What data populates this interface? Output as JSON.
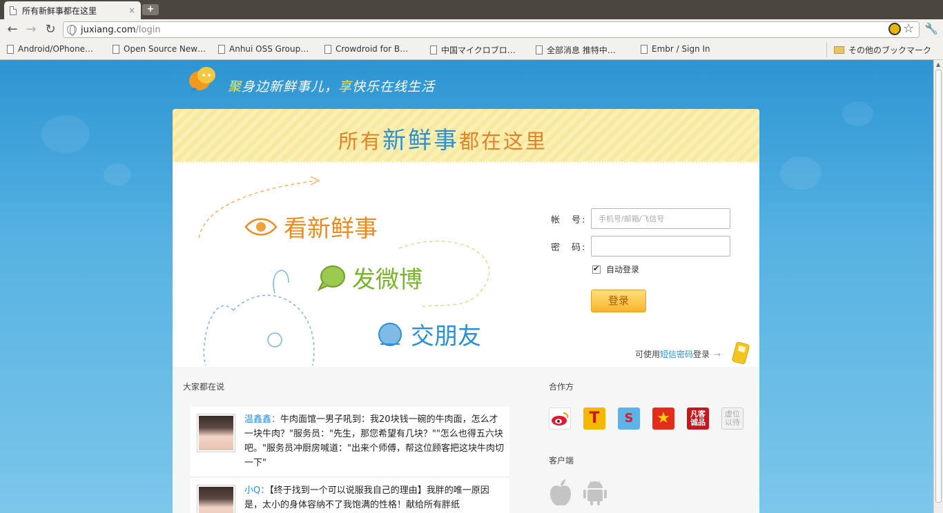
{
  "browser": {
    "tab_title": "所有新鲜事都在这里",
    "tab_close": "×",
    "new_tab": "+",
    "url_host": "juxiang.com",
    "url_path": "/login",
    "bookmarks": [
      {
        "label": "Android/OPhone…",
        "type": "page"
      },
      {
        "label": "Open Source New…",
        "type": "page"
      },
      {
        "label": "Anhui OSS Group…",
        "type": "page"
      },
      {
        "label": "Crowdroid for B…",
        "type": "page"
      },
      {
        "label": "中国マイクロブロ…",
        "type": "page"
      },
      {
        "label": "全部消息 推特中…",
        "type": "page"
      },
      {
        "label": "Embr / Sign In",
        "type": "page"
      },
      {
        "label": "その他のブックマーク",
        "type": "folder"
      }
    ]
  },
  "header": {
    "slogan_hl1": "聚",
    "slogan_part1": "身边新鲜事儿，",
    "slogan_hl2": "享",
    "slogan_part2": "快乐在线生活"
  },
  "banner": {
    "title_a": "所有",
    "title_b": "新",
    "title_c": "鲜",
    "title_d": "事",
    "title_e": "都在这里"
  },
  "features": {
    "see": "看新鲜事",
    "post": "发微博",
    "friend": "交朋友"
  },
  "login": {
    "account_label": "帐　号:",
    "account_placeholder": "手机号/邮箱/飞信号",
    "password_label": "密　码:",
    "password_value": "",
    "remember_label": "自动登录",
    "remember_checked": true,
    "submit_label": "登录",
    "sms_prefix": "可使用",
    "sms_link": "短信密码",
    "sms_suffix": "登录",
    "sms_arrow": "→"
  },
  "feed": {
    "heading": "大家都在说",
    "items": [
      {
        "author": "温鑫鑫",
        "sep": "：",
        "text": "牛肉面馆一男子吼到：我20块钱一碗的牛肉面，怎么才一块牛肉？\"服务员：\"先生，那您希望有几块？\"\"怎么也得五六块吧。\"服务员冲厨房喊道：\"出来个师傅，帮这位顾客把这块牛肉切一下\""
      },
      {
        "author": "小Q",
        "sep": "：",
        "text": "【终于找到一个可以说服我自己的理由】我胖的唯一原因是，太小的身体容纳不了我饱满的性格！献给所有胖纸"
      }
    ]
  },
  "partners": {
    "heading": "合作方",
    "items": [
      {
        "name": "weibo-icon",
        "label": "",
        "color": "#ffffff"
      },
      {
        "name": "t-icon",
        "label": "T",
        "color": "#f5b800"
      },
      {
        "name": "sohu-icon",
        "label": "S",
        "color": "#5ab4e8"
      },
      {
        "name": "star-icon",
        "label": "★",
        "color": "#e32d1a"
      },
      {
        "name": "vancl-icon",
        "label": "凡客诚品",
        "color": "#c8161d"
      },
      {
        "name": "placeholder-icon",
        "label": "虚位以待",
        "color": "#f2f2f2"
      }
    ]
  },
  "clients": {
    "heading": "客户端",
    "items": [
      "apple-icon",
      "android-icon"
    ]
  }
}
